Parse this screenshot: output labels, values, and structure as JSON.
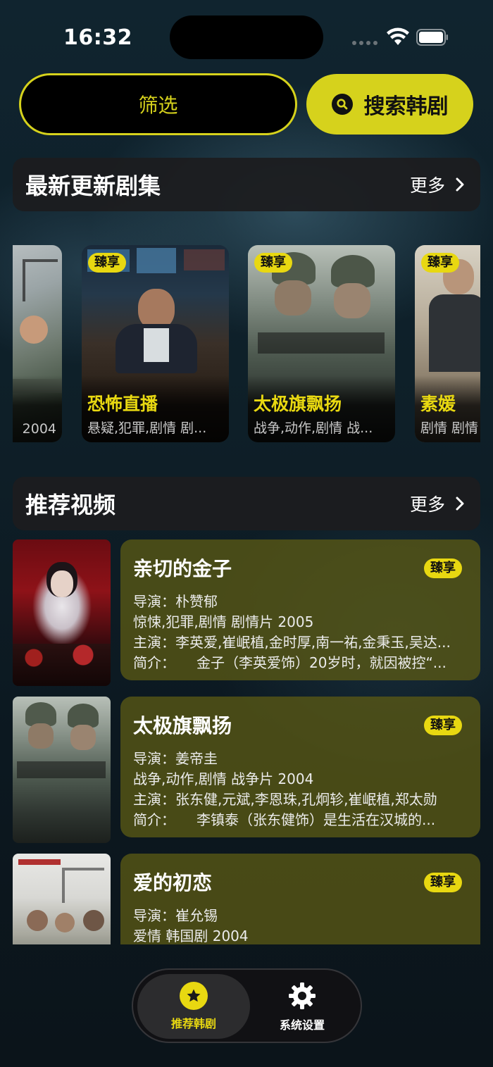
{
  "status_bar": {
    "time": "16:32"
  },
  "top_buttons": {
    "filter_label": "筛选",
    "search_label": "搜索韩剧"
  },
  "latest": {
    "title": "最新更新剧集",
    "more_label": "更多",
    "items": [
      {
        "title": "",
        "tags": "2004",
        "badge": ""
      },
      {
        "title": "恐怖直播",
        "tags": "悬疑,犯罪,剧情 剧...",
        "badge": "臻享"
      },
      {
        "title": "太极旗飘扬",
        "tags": "战争,动作,剧情 战...",
        "badge": "臻享"
      },
      {
        "title": "素媛",
        "tags": "剧情 剧情",
        "badge": "臻享"
      }
    ]
  },
  "recommended": {
    "title": "推荐视频",
    "more_label": "更多",
    "items": [
      {
        "title": "亲切的金子",
        "badge": "臻享",
        "director": "导演：朴赞郁",
        "genre": "惊悚,犯罪,剧情 剧情片 2005",
        "cast": "主演：李英爱,崔岷植,金时厚,南一祐,金秉玉,吴达...",
        "summary": "简介：　　金子（李英爱饰）20岁时，就因被控“..."
      },
      {
        "title": "太极旗飘扬",
        "badge": "臻享",
        "director": "导演：姜帝圭",
        "genre": "战争,动作,剧情 战争片 2004",
        "cast": "主演：张东健,元斌,李恩珠,孔炯轸,崔岷植,郑太勋",
        "summary": "简介：　　李镇泰（张东健饰）是生活在汉城的..."
      },
      {
        "title": "爱的初恋",
        "badge": "臻享",
        "director": "导演：崔允锡",
        "genre": "爱情 韩国剧 2004",
        "cast": "",
        "summary": ""
      }
    ]
  },
  "tabbar": {
    "tab1_label": "推荐韩剧",
    "tab2_label": "系统设置"
  },
  "colors": {
    "accent": "#e8d811",
    "card_bg": "#5a5814"
  }
}
